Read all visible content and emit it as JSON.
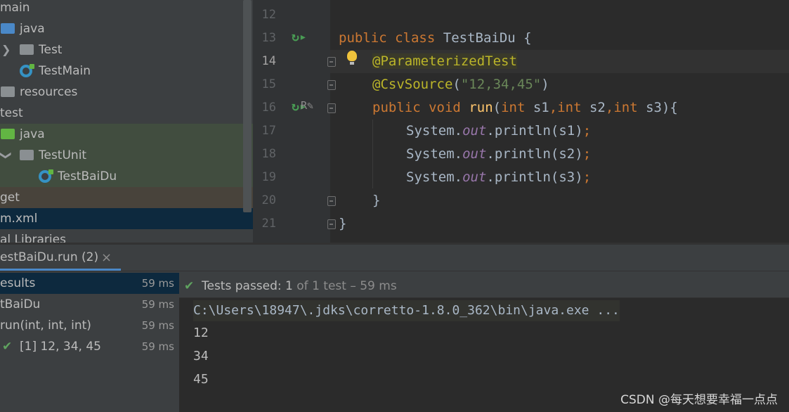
{
  "project_tree": {
    "items": [
      {
        "label": "main"
      },
      {
        "label": "java"
      },
      {
        "label": "Test"
      },
      {
        "label": "TestMain"
      },
      {
        "label": "resources"
      },
      {
        "label": "test"
      },
      {
        "label": "java"
      },
      {
        "label": "TestUnit"
      },
      {
        "label": "TestBaiDu"
      },
      {
        "label": "get"
      },
      {
        "label": "m.xml"
      },
      {
        "label": "al Libraries"
      }
    ]
  },
  "editor": {
    "line_numbers": [
      "12",
      "13",
      "14",
      "15",
      "16",
      "17",
      "18",
      "19",
      "20",
      "21"
    ],
    "current_line": "14",
    "lines": {
      "l13": {
        "kw1": "public",
        "kw2": "class",
        "name": "TestBaiDu",
        "brace": " {"
      },
      "l14": {
        "ann": "@ParameterizedTest"
      },
      "l15": {
        "ann": "@CsvSource",
        "open": "(",
        "str": "\"12,34,45\"",
        "close": ")"
      },
      "l16": {
        "kw1": "public",
        "kw2": "void",
        "fn": "run",
        "p0": "(",
        "t1": "int",
        "a1": " s1",
        "c1": ",",
        "t2": "int",
        "a2": " s2",
        "c2": ",",
        "t3": "int",
        "a3": " s3",
        "end": "){"
      },
      "l17": {
        "pre": "System.",
        "field": "out",
        "post": ".println(s1)",
        "semi": ";"
      },
      "l18": {
        "pre": "System.",
        "field": "out",
        "post": ".println(s2)",
        "semi": ";"
      },
      "l19": {
        "pre": "System.",
        "field": "out",
        "post": ".println(s3)",
        "semi": ";"
      },
      "l20": {
        "text": "}"
      },
      "l21": {
        "text": "}"
      }
    }
  },
  "run_window": {
    "tab_label": "estBaiDu.run (2)",
    "close_glyph": "×",
    "test_tree": [
      {
        "label": "esults",
        "time": "59 ms"
      },
      {
        "label": "tBaiDu",
        "time": "59 ms"
      },
      {
        "label": "run(int, int, int)",
        "time": "59 ms"
      },
      {
        "label": "[1] 12, 34, 45",
        "time": "59 ms"
      }
    ],
    "status": {
      "check": "✔",
      "prefix": "Tests passed: ",
      "count": "1",
      "suffix": " of 1 test – 59 ms"
    },
    "console": {
      "command": "C:\\Users\\18947\\.jdks\\corretto-1.8.0_362\\bin\\java.exe ...",
      "output": [
        "12",
        "34",
        "45"
      ]
    },
    "watermark": "CSDN @每天想要幸福一点点"
  },
  "colors": {
    "keyword": "#cc7832",
    "annotation": "#bbb529",
    "string": "#6a8759",
    "method": "#ffc66d",
    "static_field": "#9876aa",
    "pass": "#5fa35f"
  },
  "icons": {
    "run_gutter": "run-test-icon",
    "bulb": "lightbulb-icon",
    "folder": "folder-icon",
    "class": "class-icon"
  }
}
